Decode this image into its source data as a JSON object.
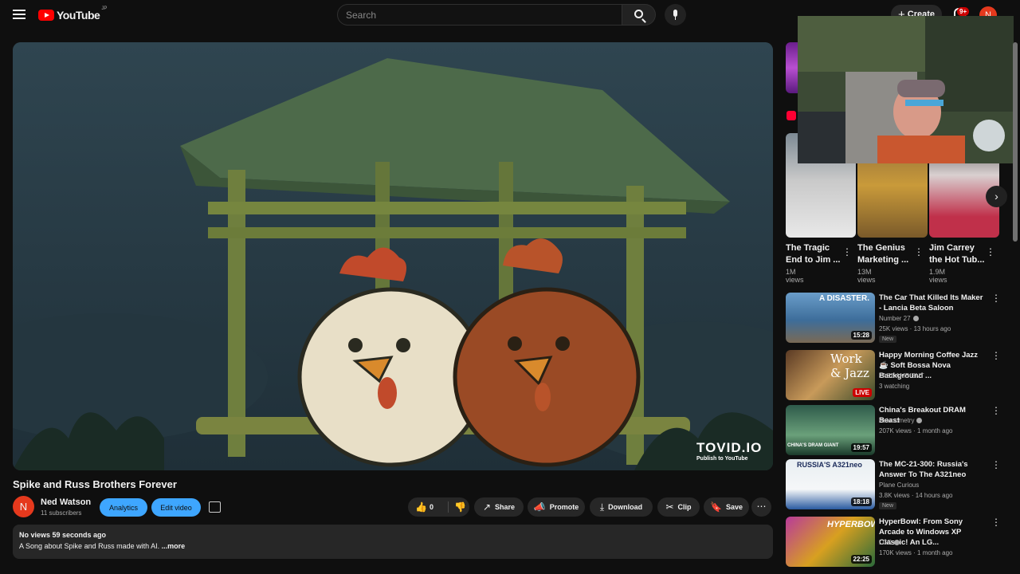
{
  "header": {
    "logo_text": "YouTube",
    "region": "JP",
    "search_placeholder": "Search",
    "create_label": "Create",
    "notifications_badge": "9+",
    "avatar_letter": "N"
  },
  "player": {
    "watermark_main": "TOVID.IO",
    "watermark_sub": "Publish to YouTube"
  },
  "video": {
    "title": "Spike and Russ Brothers Forever",
    "channel_avatar_letter": "N",
    "channel_name": "Ned Watson",
    "subscribers": "11 subscribers",
    "analytics_label": "Analytics",
    "edit_label": "Edit video",
    "like_count": "0",
    "share_label": "Share",
    "promote_label": "Promote",
    "download_label": "Download",
    "clip_label": "Clip",
    "save_label": "Save",
    "description_meta": "No views  59 seconds ago",
    "description_text": "A Song about Spike and Russ made with AI. ",
    "description_more": "...more"
  },
  "shorts": [
    {
      "title": "The Tragic End to Jim ...",
      "views": "1M views"
    },
    {
      "title": "The Genius Marketing ...",
      "views": "13M views"
    },
    {
      "title": "Jim Carrey the Hot Tub...",
      "views": "1.9M views"
    }
  ],
  "recommendations": [
    {
      "title": "The Car That Killed Its Maker - Lancia Beta Saloon",
      "channel": "Number 27",
      "stats": "25K views · 13 hours ago",
      "badge": "New",
      "duration": "15:28",
      "thumb_text": "A DISASTER."
    },
    {
      "title": "Happy Morning Coffee Jazz ☕ Soft Bossa Nova Background ...",
      "channel": "JAZZ AMBIENT",
      "stats": "3 watching",
      "badge": "",
      "duration": "LIVE",
      "thumb_text": "Work & Jazz"
    },
    {
      "title": "China's Breakout DRAM Beast",
      "channel": "Asianometry",
      "stats": "207K views · 1 month ago",
      "badge": "",
      "duration": "19:57",
      "thumb_text": "CHINA'S DRAM GIANT"
    },
    {
      "title": "The MC-21-300: Russia's Answer To The A321neo",
      "channel": "Plane Curious",
      "stats": "3.8K views · 14 hours ago",
      "badge": "New",
      "duration": "18:18",
      "thumb_text": "RUSSIA'S A321neo"
    },
    {
      "title": "HyperBowl: From Sony Arcade to Windows XP Classic! An LG...",
      "channel": "LGR",
      "stats": "170K views · 1 month ago",
      "badge": "",
      "duration": "22:25",
      "thumb_text": "HYPERBOWL"
    }
  ]
}
